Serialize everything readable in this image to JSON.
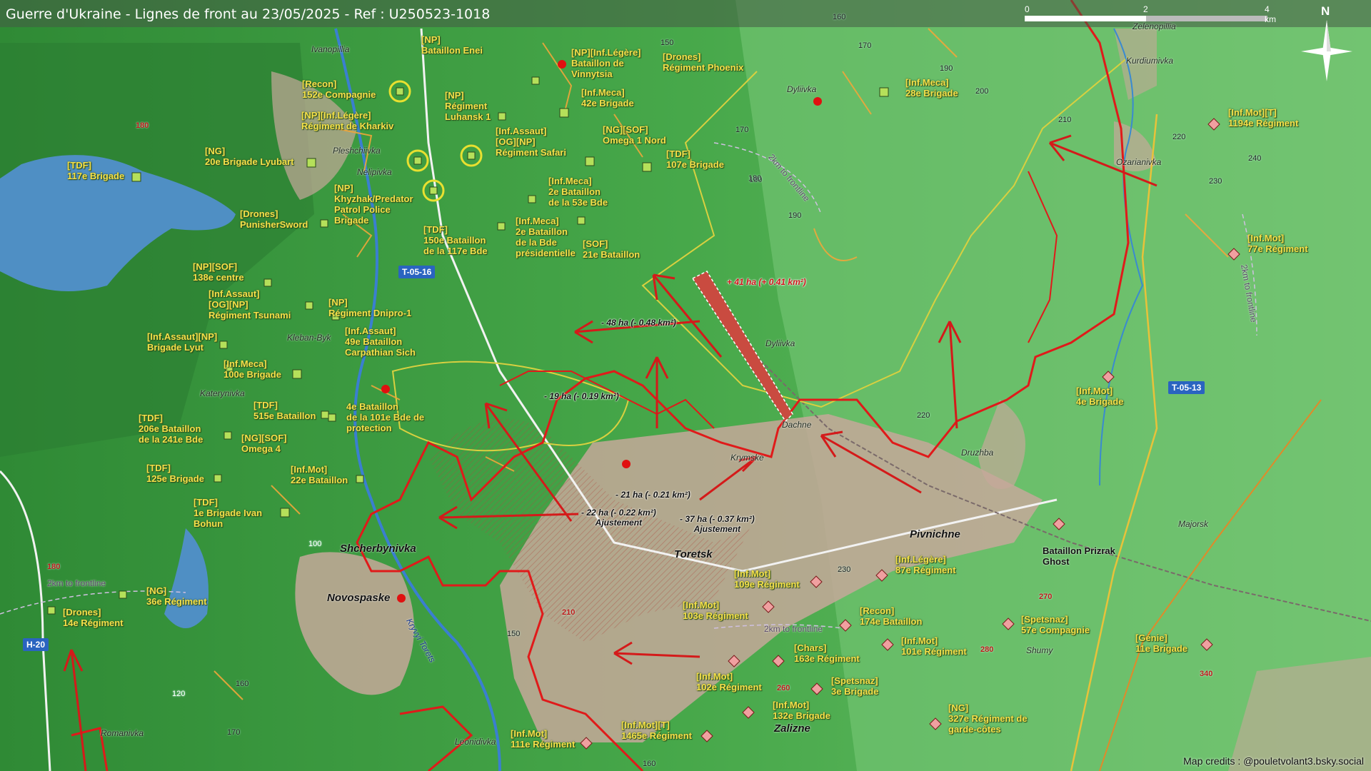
{
  "title": "Guerre d'Ukraine - Lignes de front au 23/05/2025 - Ref : U250523-1018",
  "scale": {
    "labels": [
      "0",
      "2",
      "4 km"
    ]
  },
  "north_label": "N",
  "credits": "Map credits : @pouletvolant3.bsky.social",
  "colors": {
    "front": "#e01a1a",
    "unit_text": "#f5e04a",
    "road_badge": "#2a64c0"
  },
  "units": [
    "[NP]\nBataillon Enei",
    "[NP][Inf.Légère]\nBataillon de\nVinnytsia",
    "[Drones]\nRégiment Phoenix",
    "[Inf.Meca]\n28e Brigade",
    "[Recon]\n152e Compagnie",
    "[NP]\nRégiment\nLuhansk 1",
    "[Inf.Meca]\n42e Brigade",
    "[NP][Inf.Légère]\nRégiment de Kharkiv",
    "[Inf.Assaut]\n[OG][NP]\nRégiment Safari",
    "[NG][SOF]\nOmega 1 Nord",
    "[TDF]\n107e Brigade",
    "[NG]\n20e Brigade Lyubart",
    "[TDF]\n117e Brigade",
    "[Inf.Meca]\n2e Bataillon\nde la 53e Bde",
    "[NP]\nKhyzhak/Predator\nPatrol Police\nBrigade",
    "[Drones]\nPunisherSword",
    "[Inf.Meca]\n2e Bataillon\nde la Bde\nprésidentielle",
    "[SOF]\n21e Bataillon",
    "[TDF]\n150e Bataillon\nde la 117e Bde",
    "[NP][SOF]\n138e centre",
    "[Inf.Assaut]\n[OG][NP]\nRégiment Tsunami",
    "[NP]\nRégiment Dnipro-1",
    "[Inf.Assaut][NP]\nBrigade Lyut",
    "[Inf.Assaut]\n49e Bataillon\nCarpathian Sich",
    "[Inf.Meca]\n100e Brigade",
    "[TDF]\n206e Bataillon\nde la 241e Bde",
    "[TDF]\n515e Bataillon",
    "4e Bataillon\nde la 101e Bde de\nprotection",
    "[NG][SOF]\nOmega 4",
    "[TDF]\n125e Brigade",
    "[Inf.Mot]\n22e Bataillon",
    "[TDF]\n1e Brigade Ivan\nBohun",
    "[NG]\n36e Régiment",
    "[Drones]\n14e Régiment",
    "[Inf.Mot][T]\n1194e Régiment",
    "[Inf.Mot]\n77e Régiment",
    "[Inf.Mot]\n4e Brigade",
    "Bataillon Prizrak\nGhost",
    "[Inf.Légère]\n87e Régiment",
    "[Inf.Mot]\n109e Régiment",
    "[Inf.Mot]\n103e Régiment",
    "[Recon]\n174e Bataillon",
    "[Spetsnaz]\n57e Compagnie",
    "[Chars]\n163e Régiment",
    "[Inf.Mot]\n101e Régiment",
    "[Génie]\n11e Brigade",
    "[Inf.Mot]\n102e Régiment",
    "[Spetsnaz]\n3e Brigade",
    "[Inf.Mot]\n132e Brigade",
    "[NG]\n327e Régiment de\ngarde-côtes",
    "[Inf.Mot]\n111e Régiment",
    "[Inf.Mot][T]\n1465e Régiment"
  ],
  "places": [
    "Ivanopillia",
    "Pleshchiivka",
    "Nelipivka",
    "Kleban-Byk",
    "Katerynivka",
    "Dyliivka",
    "Dyliivka",
    "Ozarianivka",
    "Kurdiumivka",
    "Zelenopillia",
    "Dachne",
    "Krymske",
    "Druzhba",
    "Majorsk",
    "Shumy",
    "Leonidivka",
    "Romanivka",
    "Kryvyi Torets"
  ],
  "big_places": [
    "Toretsk",
    "Pivnichne",
    "Shcherbynivka",
    "Novospaske",
    "Zalizne"
  ],
  "elevations": [
    "150",
    "160",
    "170",
    "180",
    "190",
    "200",
    "210",
    "220",
    "230",
    "240",
    "150",
    "170",
    "180",
    "190",
    "160",
    "170",
    "220",
    "230",
    "160",
    "150",
    "120",
    "100"
  ],
  "red_elevations": [
    "180",
    "180",
    "210",
    "260",
    "270",
    "280",
    "340"
  ],
  "roads": [
    "T-05-16",
    "T-05-13",
    "H-20"
  ],
  "areas": [
    "+ 41 ha (+ 0.41 km²)",
    "- 48 ha (- 0.48 km²)",
    "- 19 ha (- 0.19 km²)",
    "- 21 ha (- 0.21 km²)",
    "- 22 ha (- 0.22 km²)\nAjustement",
    "- 37 ha (- 0.37 km²)\nAjustement"
  ],
  "front_labels": [
    "2km to frontline",
    "2km to frontline",
    "2km to frontline",
    "2km to frontline"
  ]
}
